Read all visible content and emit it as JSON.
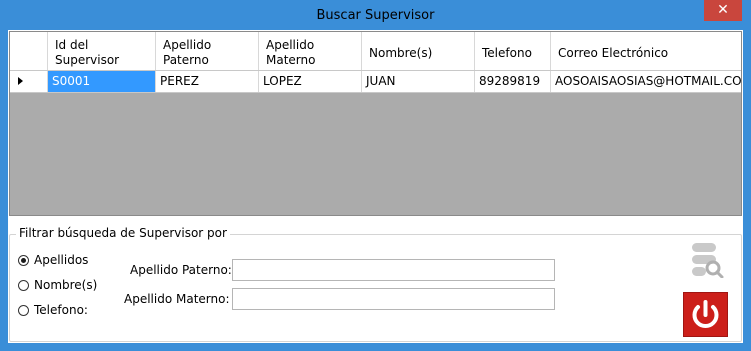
{
  "window": {
    "title": "Buscar Supervisor",
    "close_glyph": "✕"
  },
  "grid": {
    "columns": [
      "",
      "Id del\nSupervisor",
      "Apellido\nPaterno",
      "Apellido\nMaterno",
      "Nombre(s)",
      "Telefono",
      "Correo Electrónico"
    ],
    "rows": [
      {
        "id": "S0001",
        "apellido_paterno": "PEREZ",
        "apellido_materno": "LOPEZ",
        "nombres": "JUAN",
        "telefono": "89289819",
        "correo": "AOSOAISAOSIAS@HOTMAIL.COM"
      }
    ]
  },
  "filter": {
    "legend": "Filtrar búsqueda de Supervisor por",
    "options": [
      {
        "label": "Apellidos",
        "checked": true
      },
      {
        "label": "Nombre(s)",
        "checked": false
      },
      {
        "label": "Telefono:",
        "checked": false
      }
    ],
    "apellido_paterno_label": "Apellido Paterno:",
    "apellido_paterno_value": "",
    "apellido_materno_label": "Apellido Materno:",
    "apellido_materno_value": ""
  },
  "icons": {
    "search": "search-database-icon",
    "exit": "power-icon"
  },
  "colors": {
    "titlebar": "#3a8ed8",
    "close": "#c9463d",
    "selection": "#3399ff",
    "exit_button": "#cc1f1a"
  }
}
